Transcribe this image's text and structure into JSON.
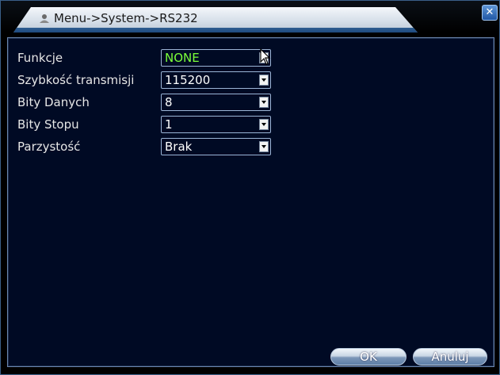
{
  "window": {
    "title": "Menu->System->RS232",
    "close_icon": "close-icon"
  },
  "form": {
    "rows": [
      {
        "label": "Funkcje",
        "value": "NONE"
      },
      {
        "label": "Szybkość transmisji",
        "value": "115200"
      },
      {
        "label": "Bity Danych",
        "value": "8"
      },
      {
        "label": "Bity Stopu",
        "value": "1"
      },
      {
        "label": "Parzystość",
        "value": "Brak"
      }
    ]
  },
  "buttons": {
    "ok": "OK",
    "cancel": "Anuluj"
  },
  "colors": {
    "panel_bg": "#000a24",
    "selected_value": "#7bff3a",
    "text": "#e6e6e6",
    "accent": "#1f56a5"
  }
}
